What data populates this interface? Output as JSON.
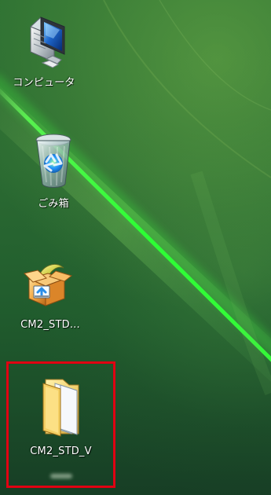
{
  "desktop": {
    "icons": [
      {
        "label": "コンピュータ",
        "icon": "computer-icon"
      },
      {
        "label": "ごみ箱",
        "icon": "recycle-bin-icon"
      },
      {
        "label": "CM2_STD...",
        "icon": "installer-box-icon"
      },
      {
        "label": "CM2_STD_V",
        "icon": "folder-icon",
        "selected": true
      }
    ]
  },
  "colors": {
    "background": "#2a6d32",
    "highlight_line": "#38ff3f",
    "selection_border": "#e00012",
    "label_text": "#ffffff"
  }
}
